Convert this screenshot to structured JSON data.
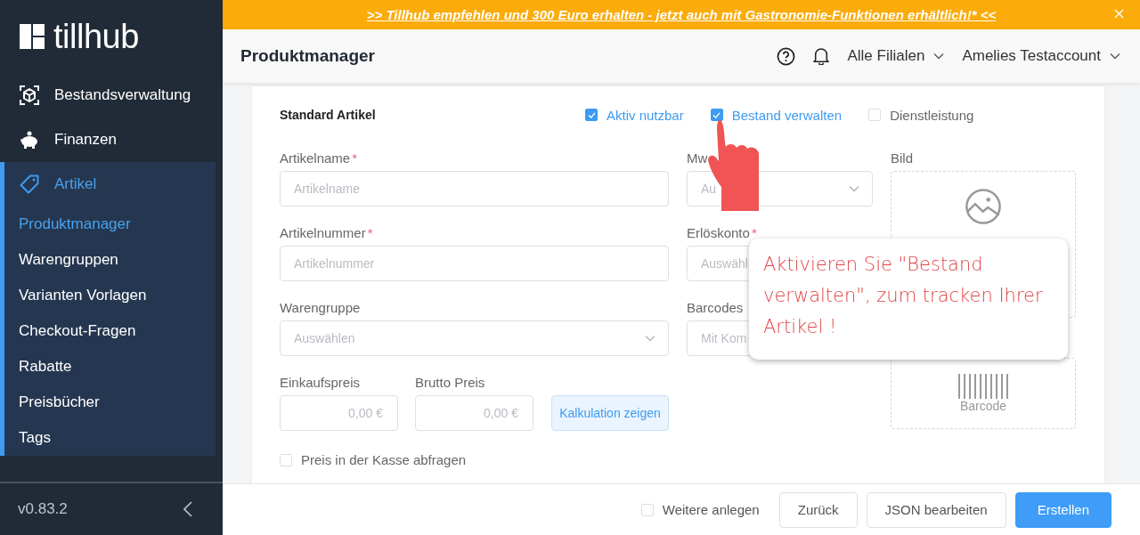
{
  "banner": {
    "text": ">> Tillhub empfehlen und 300 Euro erhalten - jetzt auch mit Gastronomie-Funktionen erhältlich!* <<"
  },
  "sidebar": {
    "logo": "tillhub",
    "version": "v0.83.2",
    "items": [
      {
        "label": "Bestandsverwaltung",
        "kind": "box",
        "selected": false
      },
      {
        "label": "Finanzen",
        "kind": "piggy",
        "selected": false
      },
      {
        "label": "Artikel",
        "kind": "tag",
        "selected": true,
        "children": [
          {
            "label": "Produktmanager",
            "selected": true
          },
          {
            "label": "Warengruppen",
            "selected": false
          },
          {
            "label": "Varianten Vorlagen",
            "selected": false
          },
          {
            "label": "Checkout-Fragen",
            "selected": false
          },
          {
            "label": "Rabatte",
            "selected": false
          },
          {
            "label": "Preisbücher",
            "selected": false
          },
          {
            "label": "Tags",
            "selected": false
          }
        ]
      }
    ]
  },
  "header": {
    "title": "Produktmanager",
    "menus": [
      "Alle Filialen",
      "Amelies Testaccount"
    ]
  },
  "form": {
    "title": "Standard Artikel",
    "flags": [
      {
        "label": "Aktiv nutzbar",
        "checked": true
      },
      {
        "label": "Bestand verwalten",
        "checked": true
      },
      {
        "label": "Dienstleistung",
        "checked": false
      }
    ],
    "fields": [
      {
        "label": "Artikelname",
        "marker": "*",
        "placeholder": "Artikelname",
        "kind": "input"
      },
      {
        "label": "Artikelnummer",
        "marker": "*",
        "placeholder": "Artikelnummer",
        "kind": "input"
      },
      {
        "label": "Warengruppe",
        "placeholder": "Auswählen",
        "kind": "select"
      }
    ],
    "side_fields": [
      {
        "label": "Mw",
        "placeholder": "Au",
        "kind": "select"
      },
      {
        "label": "Erlöskonto",
        "marker": "*",
        "placeholder": "Auswähl",
        "kind": "input"
      },
      {
        "label": "Barcodes",
        "placeholder": "Mit Kom",
        "kind": "input"
      }
    ],
    "prices": [
      {
        "label": "Einkaufspreis",
        "placeholder": "0,00 €"
      },
      {
        "label": "Brutto Preis",
        "placeholder": "0,00 €"
      }
    ],
    "calc_button": "Kalkulation zeigen",
    "image": {
      "label": "Bild"
    },
    "barcode": {
      "label": "Barcode"
    },
    "ask_price": {
      "label": "Preis in der Kasse abfragen",
      "checked": false
    }
  },
  "footer": {
    "more": {
      "label": "Weitere anlegen",
      "checked": false
    },
    "buttons": [
      {
        "label": "Zurück",
        "kind": "secondary"
      },
      {
        "label": "JSON bearbeiten",
        "kind": "secondary"
      },
      {
        "label": "Erstellen",
        "kind": "primary"
      }
    ]
  },
  "tooltip": {
    "text": "Aktivieren Sie \"Bestand verwalten\", zum tracken Ihrer Artikel !"
  }
}
